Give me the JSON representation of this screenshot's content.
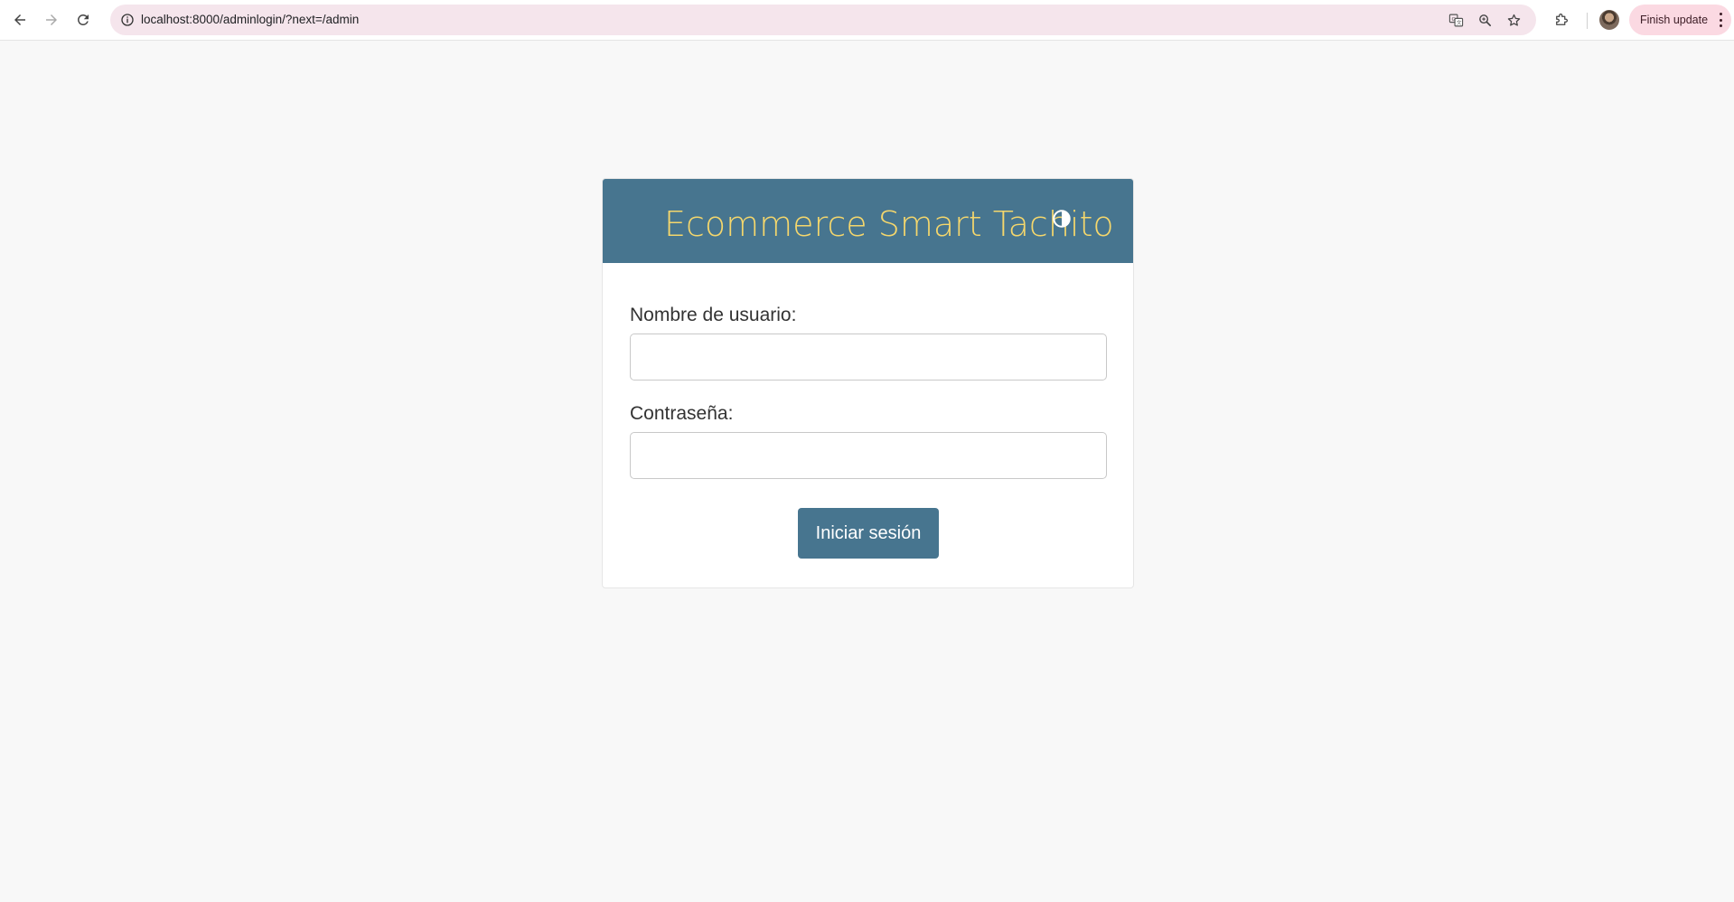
{
  "browser": {
    "url": "localhost:8000/adminlogin/?next=/admin",
    "update_button_label": "Finish update",
    "omnibox_background": "#f5e5ec",
    "update_button_background": "#fbd9e2"
  },
  "login": {
    "title": "Ecommerce Smart Tachito",
    "username_label": "Nombre de usuario:",
    "username_value": "",
    "password_label": "Contraseña:",
    "password_value": "",
    "submit_label": "Iniciar sesión",
    "theme_toggle_icon": "contrast-icon"
  },
  "colors": {
    "header_background": "#47758f",
    "title_color": "#f5d76c",
    "button_background": "#47758f",
    "page_background": "#f8f8f8"
  }
}
